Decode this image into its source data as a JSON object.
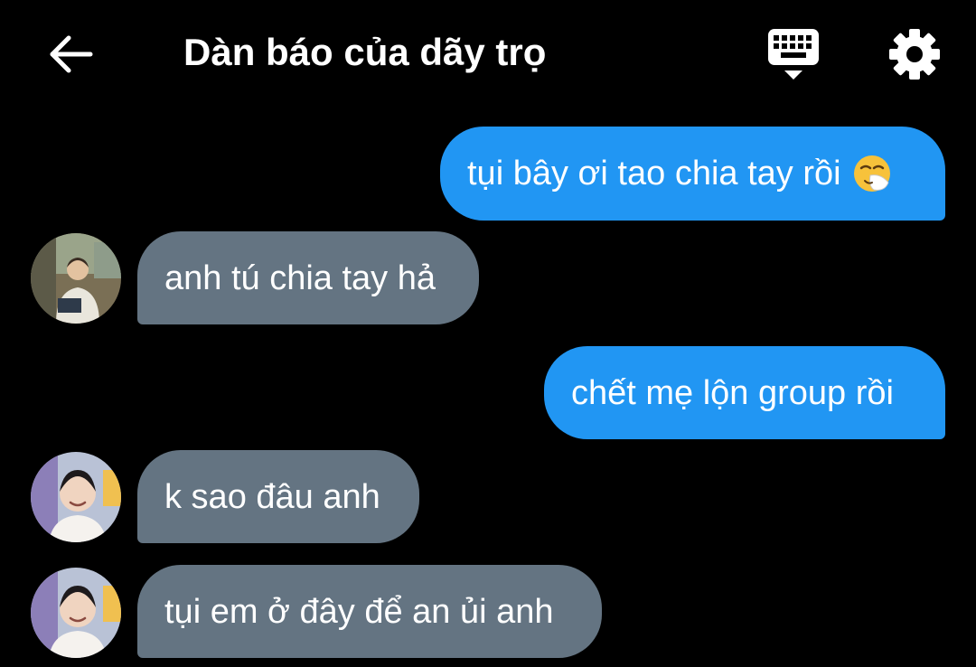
{
  "header": {
    "title": "Dàn báo của dãy trọ",
    "back_icon": "arrow-left-icon",
    "keyboard_icon": "keyboard-toggle-icon",
    "settings_icon": "gear-icon"
  },
  "colors": {
    "background": "#000000",
    "outgoing_bubble": "#2196f3",
    "incoming_bubble": "#647482",
    "text": "#ffffff"
  },
  "messages": [
    {
      "direction": "outgoing",
      "text": "tụi bây ơi tao chia tay rồi",
      "emoji": "sneezing-face-emoji"
    },
    {
      "direction": "incoming",
      "text": "anh tú chia tay hả",
      "avatar": "avatar-friend-1"
    },
    {
      "direction": "outgoing",
      "text": "chết mẹ lộn group rồi"
    },
    {
      "direction": "incoming",
      "text": "k sao đâu anh",
      "avatar": "avatar-friend-2"
    },
    {
      "direction": "incoming",
      "text": "tụi em ở đây để an ủi anh",
      "avatar": "avatar-friend-2"
    }
  ]
}
